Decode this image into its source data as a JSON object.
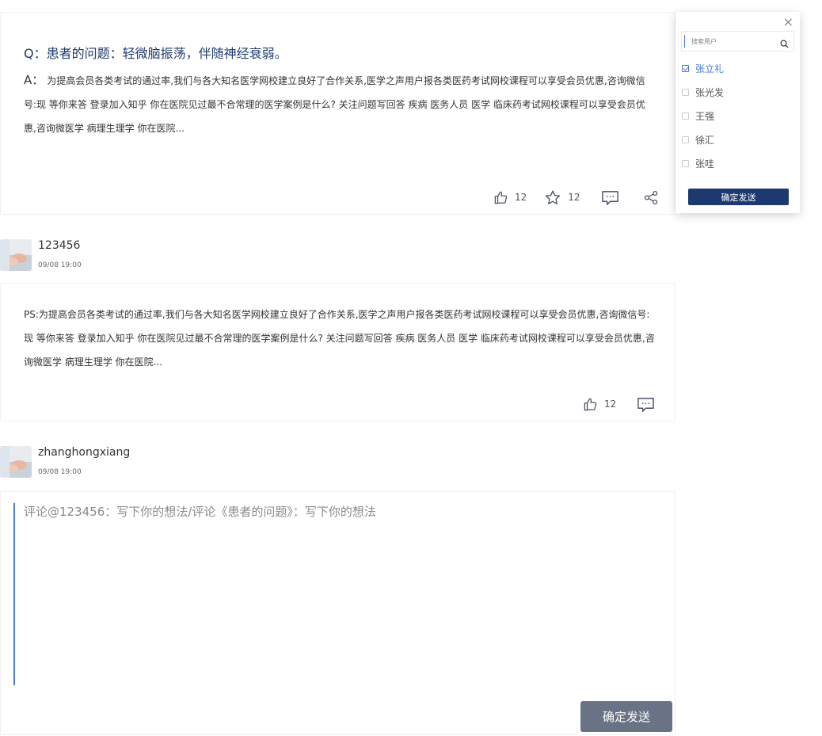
{
  "question": {
    "title": "Q：患者的问题：轻微脑振荡，伴随神经衰弱。",
    "answer_prefix": "A：",
    "answer_text": "为提高会员各类考试的通过率,我们与各大知名医学网校建立良好了合作关系,医学之声用户报各类医药考试网校课程可以享受会员优惠,咨询微信号:现 等你来答  登录加入知乎 你在医院见过最不合常理的医学案例是什么? 关注问题写回答 疾病 医务人员 医学 临床药考试网校课程可以享受会员优惠,咨询微医学 病理生理学 你在医院...",
    "like_count": "12",
    "fav_count": "12",
    "icons": [
      "thumb-up-icon",
      "star-icon",
      "comment-icon",
      "share-icon"
    ]
  },
  "reply": {
    "user": "123456",
    "time": "09/08 19:00",
    "text": "PS:为提高会员各类考试的通过率,我们与各大知名医学网校建立良好了合作关系,医学之声用户报各类医药考试网校课程可以享受会员优惠,咨询微信号:现 等你来答  登录加入知乎 你在医院见过最不合常理的医学案例是什么? 关注问题写回答 疾病 医务人员 医学 临床药考试网校课程可以享受会员优惠,咨询微医学 病理生理学 你在医院...",
    "like_count": "12"
  },
  "comment": {
    "user": "zhanghongxiang",
    "time": "09/08 19:00",
    "placeholder": "评论@123456：写下你的想法/评论《患者的问题》：写下你的想法",
    "send_label": "确定发送"
  },
  "share_popup": {
    "search_placeholder": "搜索用户",
    "users": [
      {
        "name": "张立礼",
        "checked": true
      },
      {
        "name": "张光发",
        "checked": false
      },
      {
        "name": "王强",
        "checked": false
      },
      {
        "name": "徐汇",
        "checked": false
      },
      {
        "name": "张哇",
        "checked": false
      }
    ],
    "confirm_label": "确定发送",
    "close_label": "×"
  },
  "colors": {
    "accent": "#4a7bd0",
    "primary_dark": "#1d3a70",
    "send_button": "#6a7386",
    "title": "#1f3a6b"
  }
}
